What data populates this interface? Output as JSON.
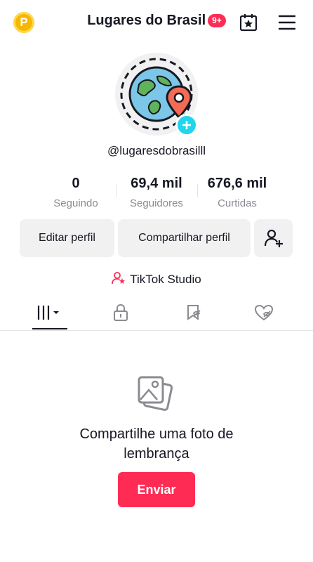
{
  "header": {
    "coin_letter": "P",
    "title": "Lugares do Brasil",
    "notification_badge": "9+",
    "icons": [
      "calendar-star-icon",
      "menu-icon"
    ]
  },
  "profile": {
    "username": "@lugaresdobrasilll",
    "stats": [
      {
        "value": "0",
        "label": "Seguindo"
      },
      {
        "value": "69,4 mil",
        "label": "Seguidores"
      },
      {
        "value": "676,6 mil",
        "label": "Curtidas"
      }
    ],
    "buttons": {
      "edit": "Editar perfil",
      "share": "Compartilhar perfil"
    },
    "studio_link": "TikTok Studio"
  },
  "tabs": {
    "items": [
      "grid-icon",
      "lock-icon",
      "tag-icon",
      "liked-icon"
    ],
    "active_index": 0
  },
  "empty_state": {
    "line1": "Compartilhe uma foto de",
    "line2": "lembrança",
    "button": "Enviar"
  },
  "colors": {
    "accent": "#fe2c55",
    "plus": "#20d5ec",
    "coin": "#f6b700"
  }
}
